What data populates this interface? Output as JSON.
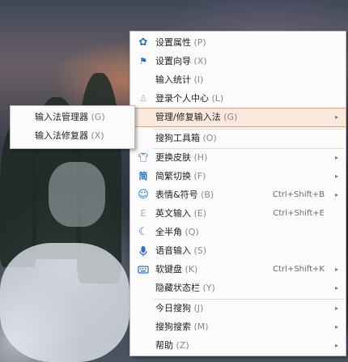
{
  "menu": {
    "items": [
      {
        "label": "设置属性",
        "hotkey": "(P)",
        "icon": "gear-icon",
        "shortcut": "",
        "arrow": ""
      },
      {
        "label": "设置向导",
        "hotkey": "(X)",
        "icon": "flag-icon",
        "shortcut": "",
        "arrow": ""
      },
      {
        "label": "输入统计",
        "hotkey": "(I)",
        "icon": "",
        "shortcut": "",
        "arrow": ""
      },
      {
        "label": "登录个人中心",
        "hotkey": "(L)",
        "icon": "user-icon",
        "shortcut": "",
        "arrow": ""
      },
      {
        "label": "管理/修复输入法",
        "hotkey": "(G)",
        "icon": "",
        "shortcut": "",
        "arrow": "▸"
      },
      {
        "label": "搜狗工具箱",
        "hotkey": "(O)",
        "icon": "",
        "shortcut": "",
        "arrow": ""
      },
      {
        "label": "更换皮肤",
        "hotkey": "(H)",
        "icon": "shirt-icon",
        "shortcut": "",
        "arrow": "▸"
      },
      {
        "label": "简繁切换",
        "hotkey": "(F)",
        "icon": "simplified-traditional-icon",
        "shortcut": "",
        "arrow": "▸"
      },
      {
        "label": "表情&符号",
        "hotkey": "(B)",
        "icon": "smiley-icon",
        "shortcut": "Ctrl+Shift+B",
        "arrow": "▸"
      },
      {
        "label": "英文输入",
        "hotkey": "(E)",
        "icon": "letter-e-icon",
        "shortcut": "Ctrl+Shift+E",
        "arrow": ""
      },
      {
        "label": "全半角",
        "hotkey": "(Q)",
        "icon": "moon-icon",
        "shortcut": "",
        "arrow": ""
      },
      {
        "label": "语音输入",
        "hotkey": "(S)",
        "icon": "microphone-icon",
        "shortcut": "",
        "arrow": ""
      },
      {
        "label": "软键盘",
        "hotkey": "(K)",
        "icon": "keyboard-icon",
        "shortcut": "Ctrl+Shift+K",
        "arrow": "▸"
      },
      {
        "label": "隐藏状态栏",
        "hotkey": "(Y)",
        "icon": "",
        "shortcut": "",
        "arrow": "▸"
      },
      {
        "label": "今日搜狗",
        "hotkey": "(J)",
        "icon": "",
        "shortcut": "",
        "arrow": "▸"
      },
      {
        "label": "搜狗搜索",
        "hotkey": "(M)",
        "icon": "",
        "shortcut": "",
        "arrow": "▸"
      },
      {
        "label": "帮助",
        "hotkey": "(Z)",
        "icon": "",
        "shortcut": "",
        "arrow": "▸"
      }
    ],
    "highlighted_index": 4
  },
  "submenu": {
    "items": [
      {
        "label": "输入法管理器",
        "hotkey": "(G)"
      },
      {
        "label": "输入法修复器",
        "hotkey": "(X)"
      }
    ]
  },
  "colors": {
    "icon_blue": "#2b6fd0",
    "highlight_bg": "#fbe9dd",
    "highlight_border": "#e5a37a"
  }
}
